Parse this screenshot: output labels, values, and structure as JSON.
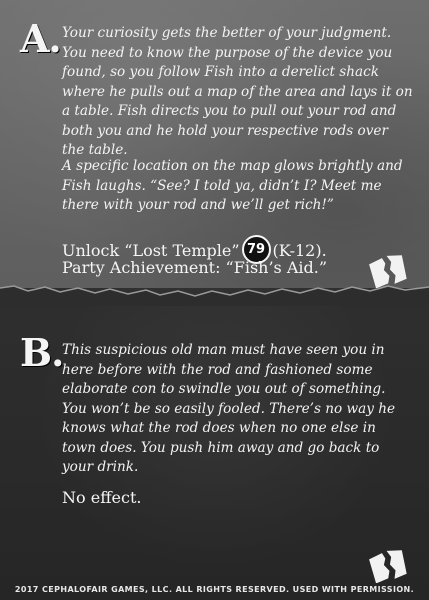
{
  "option_a": {
    "letter": "A.",
    "paragraph_1": "Your curiosity gets the better of your judgment. You need to know the purpose of the device you found, so you follow Fish into a derelict shack where he pulls out a map of the area and lays it on a table. Fish directs you to pull out your rod and both you and he hold your respective rods over the table.",
    "paragraph_2": "A specific location on the map glows brightly and Fish laughs. “See? I told ya, didn’t I? Meet me there with your rod and we’ll get rich!”",
    "unlock_prefix": "Unlock “Lost Temple”",
    "unlock_number": "79",
    "unlock_suffix": "(K-12).",
    "party_achievement": "Party Achievement: “Fish’s Aid.”",
    "seal_icon": "torn-seal-icon"
  },
  "option_b": {
    "letter": "B.",
    "paragraph_1": "This suspicious old man must have seen you in here before with the rod and fashioned some elaborate con to swindle you out of something. You won’t be so easily fooled. There’s no way he knows what the rod does when no one else in town does. You push him away and go back to your drink.",
    "outcome": "No effect.",
    "seal_icon": "torn-seal-icon"
  },
  "footer": "2017 CEPHALOFAIR GAMES, LLC. ALL RIGHTS RESERVED. USED WITH PERMISSION."
}
